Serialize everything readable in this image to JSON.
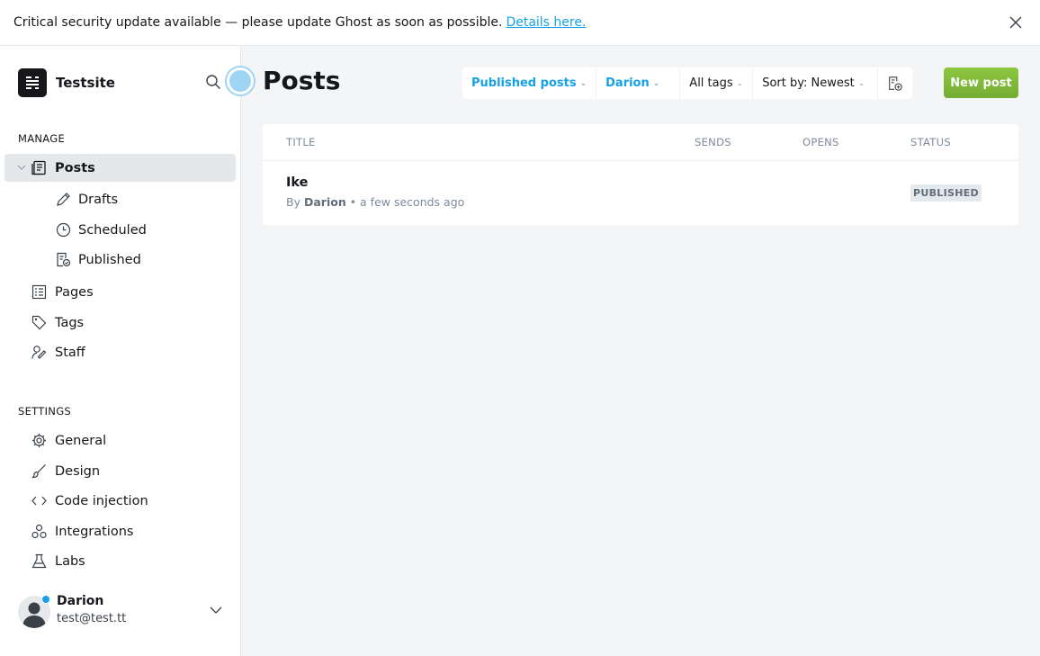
{
  "banner": {
    "message": "Critical security update available — please update Ghost as soon as possible.",
    "link": "Details here."
  },
  "sidebar": {
    "site_name": "Testsite",
    "manage_title": "MANAGE",
    "settings_title": "SETTINGS",
    "manage_items": [
      {
        "label": "Posts",
        "icon": "posts-icon",
        "active": true
      },
      {
        "label": "Drafts",
        "icon": "pencil-icon"
      },
      {
        "label": "Scheduled",
        "icon": "clock-icon"
      },
      {
        "label": "Published",
        "icon": "published-icon"
      },
      {
        "label": "Pages",
        "icon": "pages-icon"
      },
      {
        "label": "Tags",
        "icon": "tag-icon"
      },
      {
        "label": "Staff",
        "icon": "staff-icon"
      }
    ],
    "settings_items": [
      {
        "label": "General",
        "icon": "gear-icon"
      },
      {
        "label": "Design",
        "icon": "brush-icon"
      },
      {
        "label": "Code injection",
        "icon": "code-icon"
      },
      {
        "label": "Integrations",
        "icon": "integrations-icon"
      },
      {
        "label": "Labs",
        "icon": "flask-icon"
      }
    ]
  },
  "user": {
    "name": "Darion",
    "email": "test@test.tt"
  },
  "main": {
    "title": "Posts",
    "filters": {
      "type": "Published posts",
      "author": "Darion",
      "tags": "All tags",
      "sort": "Sort by: Newest"
    },
    "new_post_label": "New post",
    "table": {
      "headers": [
        "TITLE",
        "SENDS",
        "OPENS",
        "STATUS"
      ],
      "rows": [
        {
          "title": "Ike",
          "by": "By",
          "author": "Darion",
          "time": "• a few seconds ago",
          "status": "PUBLISHED"
        }
      ]
    }
  },
  "colors": {
    "accent_blue": "#14a1e6",
    "green": "#7cb342",
    "dark": "#15171a"
  }
}
